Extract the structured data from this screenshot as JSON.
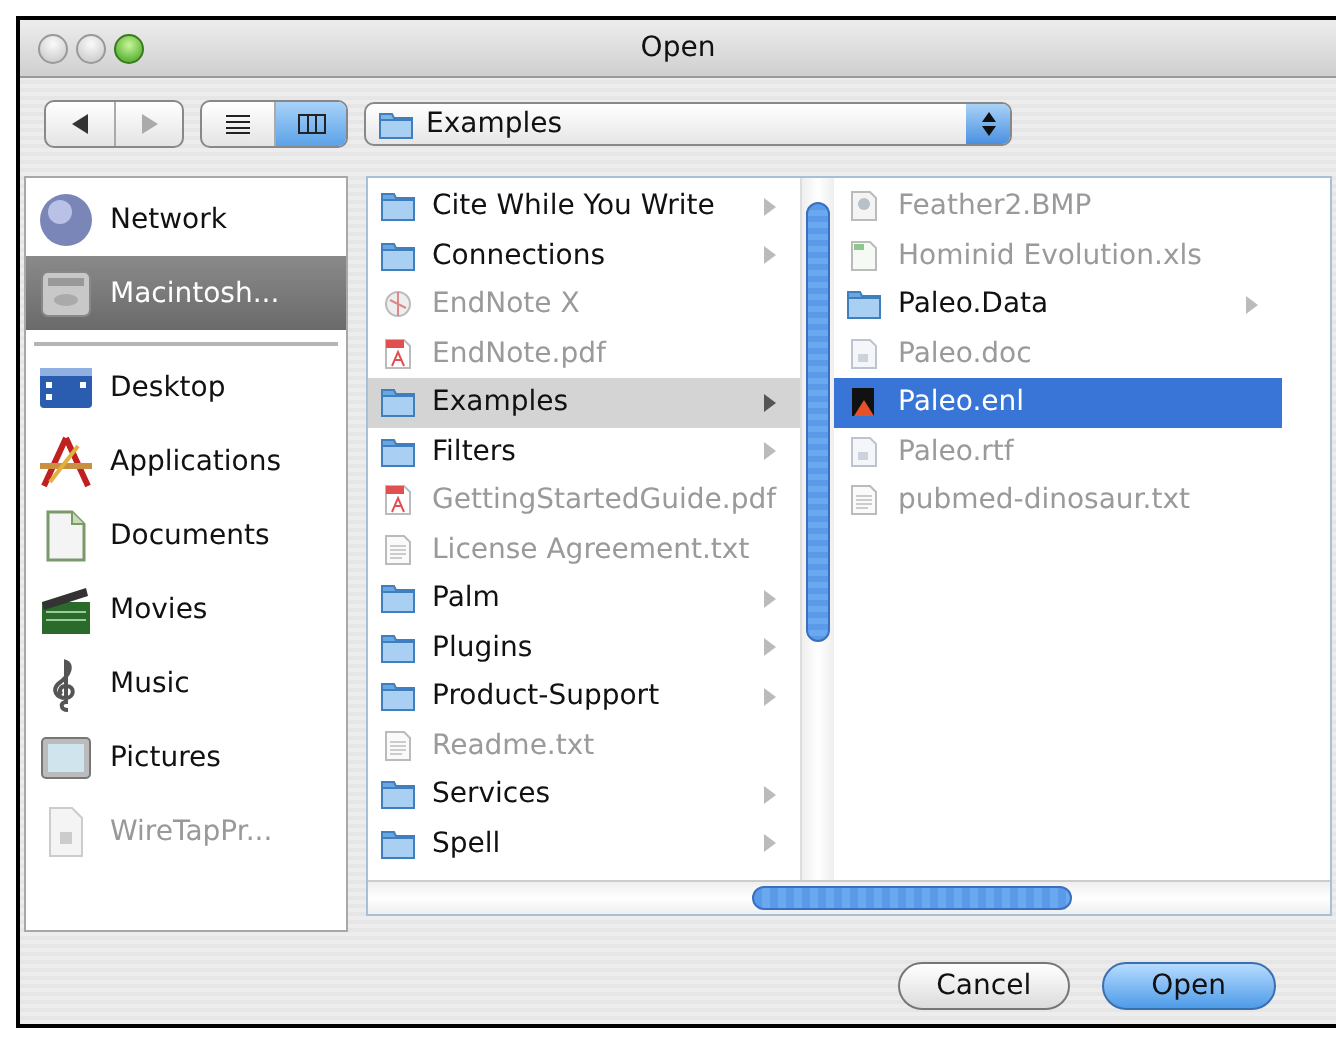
{
  "window": {
    "title": "Open"
  },
  "toolbar": {
    "view_buttons": [
      {
        "kind": "list",
        "selected": false
      },
      {
        "kind": "columns",
        "selected": true
      }
    ],
    "location": "Examples"
  },
  "sidebar": {
    "devices": [
      {
        "label": "Network",
        "kind": "network",
        "selected": false,
        "disabled": false
      },
      {
        "label": "Macintosh...",
        "kind": "disk",
        "selected": true,
        "disabled": false
      }
    ],
    "places": [
      {
        "label": "Desktop",
        "kind": "desktop",
        "selected": false,
        "disabled": false
      },
      {
        "label": "Applications",
        "kind": "applications",
        "selected": false,
        "disabled": false
      },
      {
        "label": "Documents",
        "kind": "documents",
        "selected": false,
        "disabled": false
      },
      {
        "label": "Movies",
        "kind": "movies",
        "selected": false,
        "disabled": false
      },
      {
        "label": "Music",
        "kind": "music",
        "selected": false,
        "disabled": false
      },
      {
        "label": "Pictures",
        "kind": "pictures",
        "selected": false,
        "disabled": false
      },
      {
        "label": "WireTapPr...",
        "kind": "file",
        "selected": false,
        "disabled": true
      }
    ]
  },
  "columns": [
    {
      "items": [
        {
          "name": "Cite While You Write",
          "kind": "folder",
          "selected": false,
          "disabled": false
        },
        {
          "name": "Connections",
          "kind": "folder",
          "selected": false,
          "disabled": false
        },
        {
          "name": "EndNote X",
          "kind": "app",
          "selected": false,
          "disabled": true
        },
        {
          "name": "EndNote.pdf",
          "kind": "pdf",
          "selected": false,
          "disabled": true
        },
        {
          "name": "Examples",
          "kind": "folder",
          "selected": true,
          "disabled": false
        },
        {
          "name": "Filters",
          "kind": "folder",
          "selected": false,
          "disabled": false
        },
        {
          "name": "GettingStartedGuide.pdf",
          "kind": "pdf",
          "selected": false,
          "disabled": true
        },
        {
          "name": "License Agreement.txt",
          "kind": "text",
          "selected": false,
          "disabled": true
        },
        {
          "name": "Palm",
          "kind": "folder",
          "selected": false,
          "disabled": false
        },
        {
          "name": "Plugins",
          "kind": "folder",
          "selected": false,
          "disabled": false
        },
        {
          "name": "Product-Support",
          "kind": "folder",
          "selected": false,
          "disabled": false
        },
        {
          "name": "Readme.txt",
          "kind": "text",
          "selected": false,
          "disabled": true
        },
        {
          "name": "Services",
          "kind": "folder",
          "selected": false,
          "disabled": false
        },
        {
          "name": "Spell",
          "kind": "folder",
          "selected": false,
          "disabled": false
        }
      ]
    },
    {
      "items": [
        {
          "name": "Feather2.BMP",
          "kind": "image",
          "selected": false,
          "disabled": true
        },
        {
          "name": "Hominid Evolution.xls",
          "kind": "spreadsheet",
          "selected": false,
          "disabled": true
        },
        {
          "name": "Paleo.Data",
          "kind": "folder",
          "selected": false,
          "disabled": false
        },
        {
          "name": "Paleo.doc",
          "kind": "doc",
          "selected": false,
          "disabled": true
        },
        {
          "name": "Paleo.enl",
          "kind": "library",
          "selected": true,
          "disabled": false
        },
        {
          "name": "Paleo.rtf",
          "kind": "doc",
          "selected": false,
          "disabled": true
        },
        {
          "name": "pubmed-dinosaur.txt",
          "kind": "text",
          "selected": false,
          "disabled": true
        }
      ]
    }
  ],
  "buttons": [
    {
      "label": "Cancel",
      "kind": "normal"
    },
    {
      "label": "Open",
      "kind": "default"
    }
  ]
}
